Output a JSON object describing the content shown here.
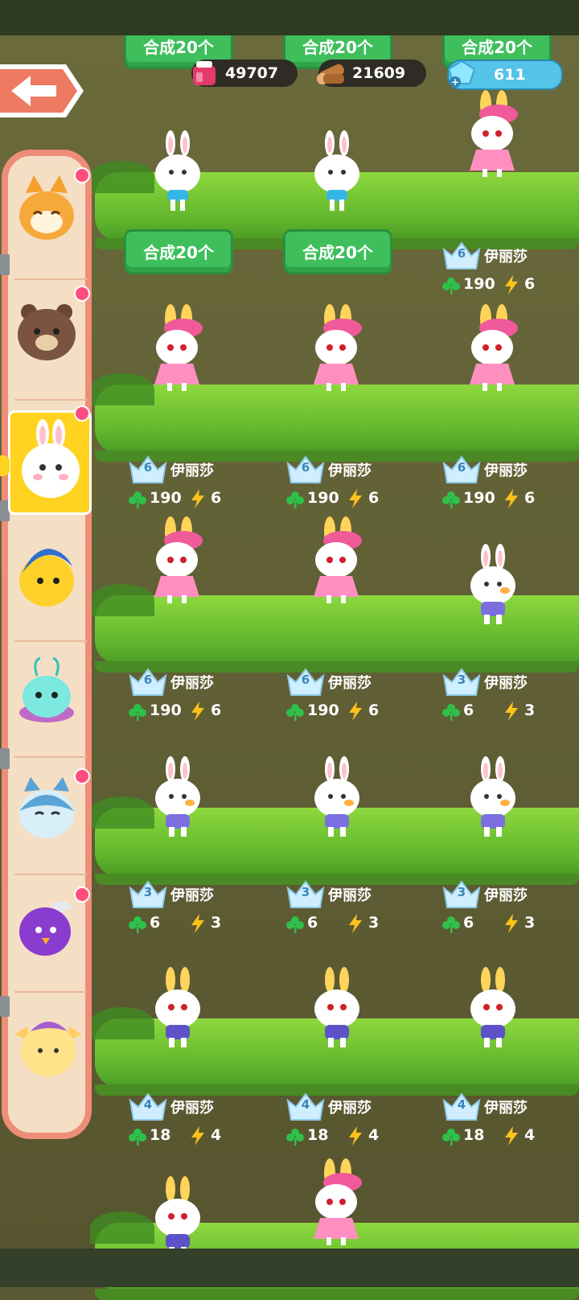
{
  "colors": {
    "button_green": "#3fbf5c",
    "sidebar_border": "#ee8e78",
    "selected_tab": "#ffd320",
    "badge": "#ff4d7d",
    "clover": "#2fc04a",
    "bolt": "#ffc21a"
  },
  "resources": {
    "potion": {
      "icon": "potion-icon",
      "value": "49707"
    },
    "wood": {
      "icon": "wood-log-icon",
      "value": "21609"
    },
    "gems": {
      "icon": "gem-icon",
      "value": "611"
    }
  },
  "buttons": {
    "merge_label": "合成20个"
  },
  "sidebar": {
    "items": [
      {
        "name": "orange-cat",
        "badge": true,
        "selected": false
      },
      {
        "name": "brown-bear",
        "badge": true,
        "selected": false
      },
      {
        "name": "white-bunny",
        "badge": true,
        "selected": true
      },
      {
        "name": "yellow-bird",
        "badge": false,
        "selected": false
      },
      {
        "name": "cyan-bug",
        "badge": false,
        "selected": false
      },
      {
        "name": "blue-whale-cat",
        "badge": true,
        "selected": false
      },
      {
        "name": "purple-bird",
        "badge": true,
        "selected": false
      },
      {
        "name": "horned-yellow",
        "badge": false,
        "selected": false
      }
    ]
  },
  "cards": [
    {
      "level": "6",
      "name": "伊丽莎",
      "clover": "190",
      "energy": "6"
    },
    {
      "level": "6",
      "name": "伊丽莎",
      "clover": "190",
      "energy": "6"
    },
    {
      "level": "6",
      "name": "伊丽莎",
      "clover": "190",
      "energy": "6"
    },
    {
      "level": "6",
      "name": "伊丽莎",
      "clover": "190",
      "energy": "6"
    },
    {
      "level": "6",
      "name": "伊丽莎",
      "clover": "190",
      "energy": "6"
    },
    {
      "level": "6",
      "name": "伊丽莎",
      "clover": "190",
      "energy": "6"
    },
    {
      "level": "3",
      "name": "伊丽莎",
      "clover": "6",
      "energy": "3"
    },
    {
      "level": "3",
      "name": "伊丽莎",
      "clover": "6",
      "energy": "3"
    },
    {
      "level": "3",
      "name": "伊丽莎",
      "clover": "6",
      "energy": "3"
    },
    {
      "level": "3",
      "name": "伊丽莎",
      "clover": "6",
      "energy": "3"
    },
    {
      "level": "4",
      "name": "伊丽莎",
      "clover": "18",
      "energy": "4"
    },
    {
      "level": "4",
      "name": "伊丽莎",
      "clover": "18",
      "energy": "4"
    },
    {
      "level": "4",
      "name": "伊丽莎",
      "clover": "18",
      "energy": "4"
    }
  ]
}
